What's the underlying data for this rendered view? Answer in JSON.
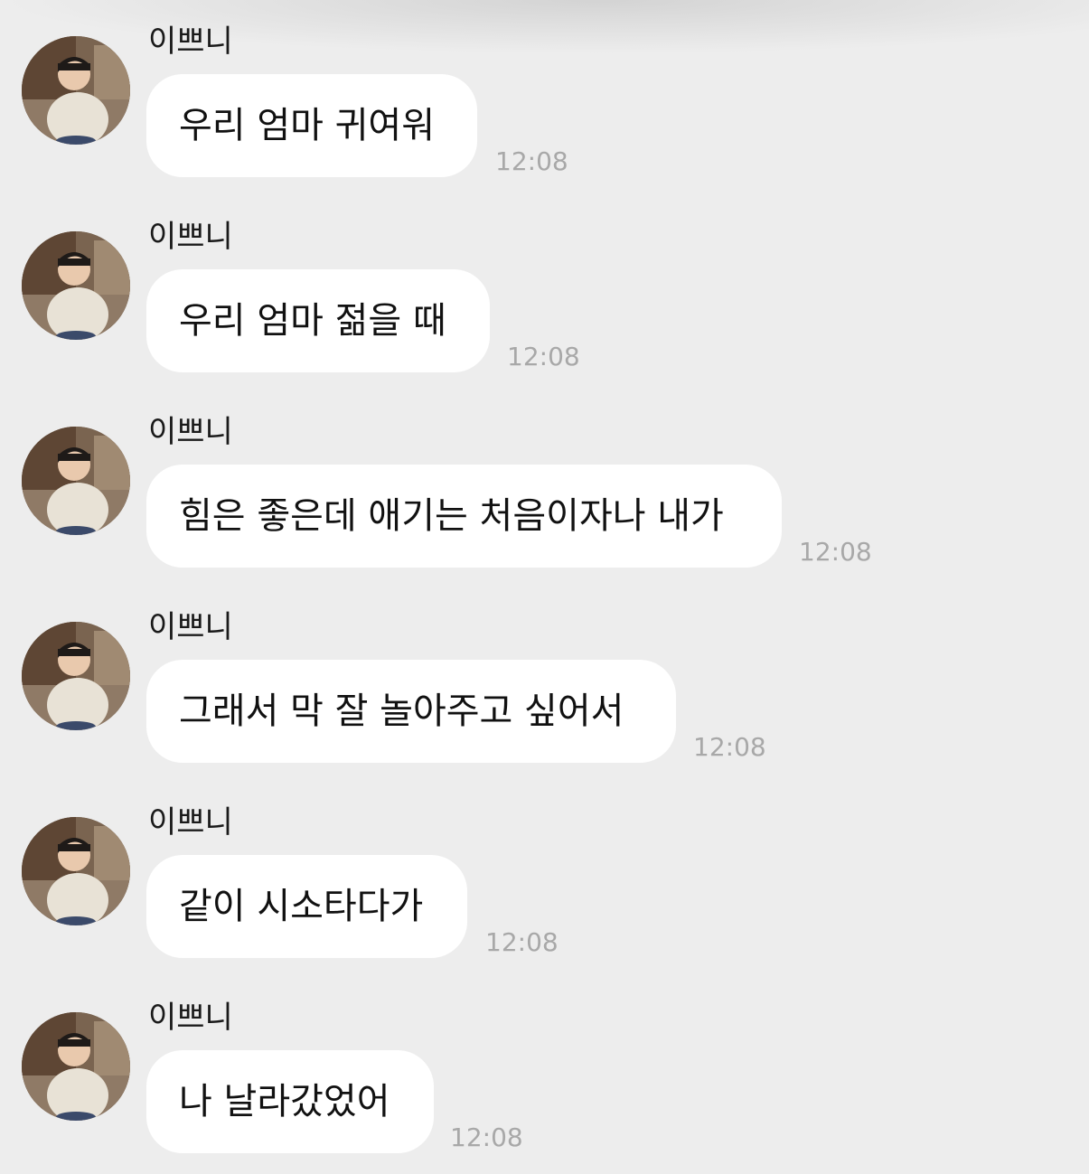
{
  "chat": {
    "messages": [
      {
        "sender": "이쁘니",
        "text": "우리 엄마 귀여워",
        "time": "12:08"
      },
      {
        "sender": "이쁘니",
        "text": "우리 엄마 젊을 때",
        "time": "12:08"
      },
      {
        "sender": "이쁘니",
        "text": "힘은 좋은데 애기는 처음이자나 내가",
        "time": "12:08"
      },
      {
        "sender": "이쁘니",
        "text": "그래서 막 잘 놀아주고 싶어서",
        "time": "12:08"
      },
      {
        "sender": "이쁘니",
        "text": "같이 시소타다가",
        "time": "12:08"
      },
      {
        "sender": "이쁘니",
        "text": "나 날라갔었어",
        "time": "12:08"
      }
    ]
  },
  "colors": {
    "background": "#ededed",
    "bubble": "#ffffff",
    "timestamp": "#a8a8a8"
  }
}
